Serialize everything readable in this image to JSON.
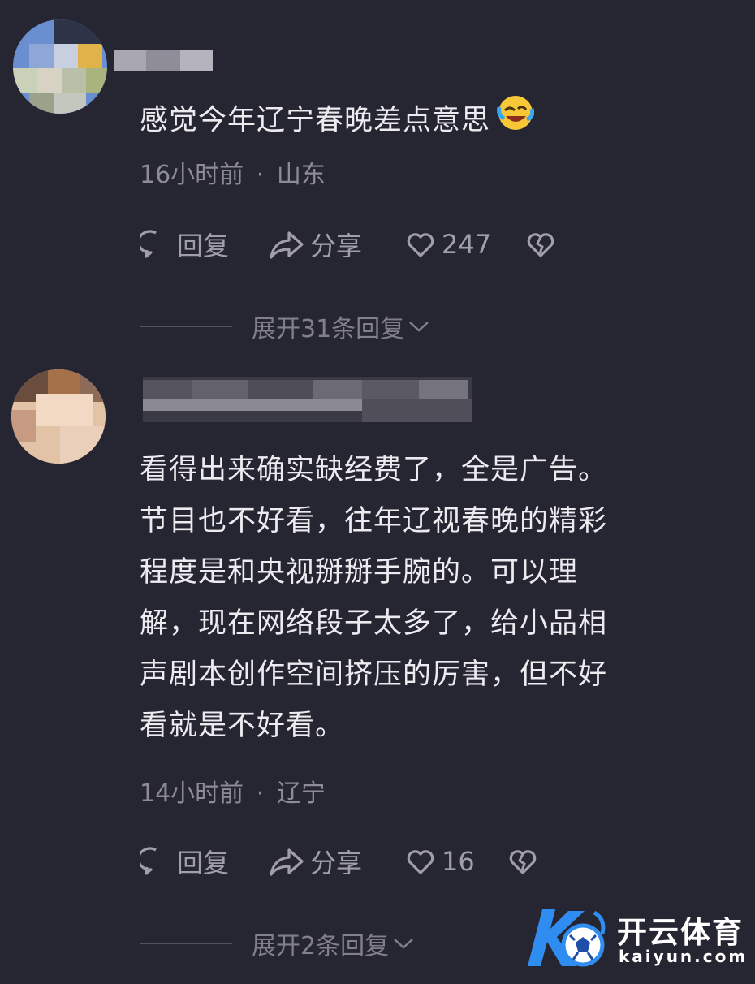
{
  "comments": [
    {
      "text": "感觉今年辽宁春晚差点意思",
      "emoji": "crying-laughing",
      "time": "16小时前",
      "location": "山东",
      "reply_label": "回复",
      "share_label": "分享",
      "likes": "247",
      "expand_label": "展开31条回复"
    },
    {
      "text": "看得出来确实缺经费了，全是广告。节目也不好看，往年辽视春晚的精彩程度是和央视掰掰手腕的。可以理解，现在网络段子太多了，给小品相声剧本创作空间挤压的厉害，但不好看就是不好看。",
      "lines": [
        "看得出来确实缺经费了，全是广告。",
        "节目也不好看，往年辽视春晚的精彩",
        "程度是和央视掰掰手腕的。可以理",
        "解，现在网络段子太多了，给小品相",
        "声剧本创作空间挤压的厉害，但不好",
        "看就是不好看。"
      ],
      "time": "14小时前",
      "location": "辽宁",
      "reply_label": "回复",
      "share_label": "分享",
      "likes": "16",
      "expand_label": "展开2条回复"
    }
  ],
  "meta_separator": "·",
  "watermark": {
    "brand": "开云体育",
    "url": "kaiyun.com"
  },
  "colors": {
    "background": "#262632",
    "text": "#ecebf0",
    "muted": "#8c8b96",
    "watermark_blue": "#2f8cf0"
  }
}
